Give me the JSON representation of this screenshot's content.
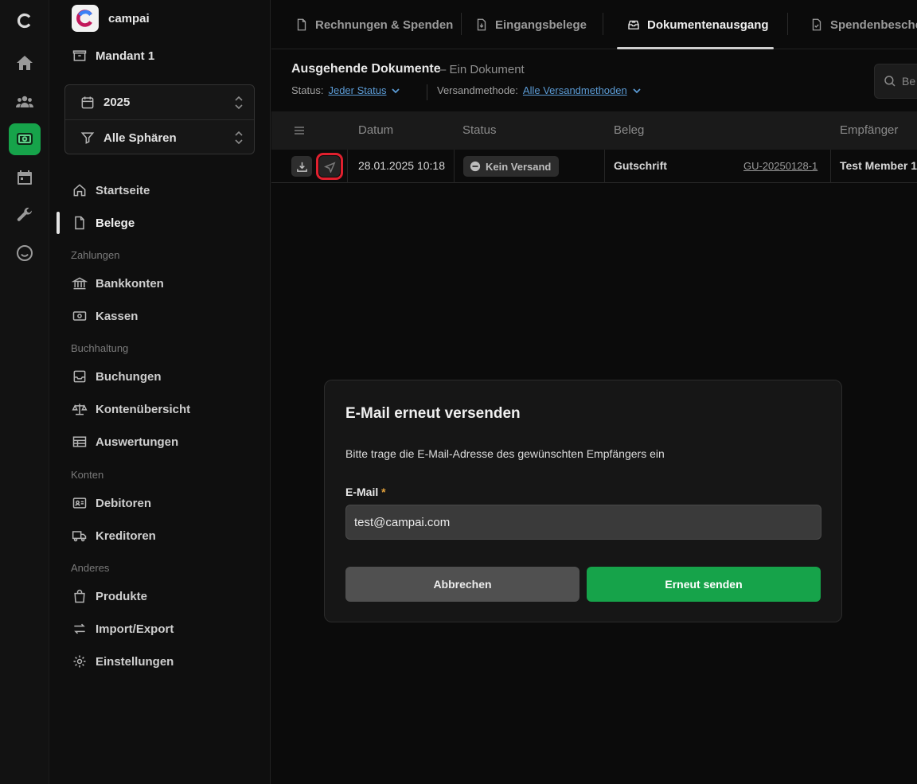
{
  "org": {
    "name": "campai"
  },
  "mandant": {
    "label": "Mandant 1"
  },
  "selector": {
    "year": "2025",
    "sphere": "Alle Sphären"
  },
  "nav": {
    "startseite": "Startseite",
    "belege": "Belege",
    "section_zahlungen": "Zahlungen",
    "bankkonten": "Bankkonten",
    "kassen": "Kassen",
    "section_buchhaltung": "Buchhaltung",
    "buchungen": "Buchungen",
    "kontenuebersicht": "Kontenübersicht",
    "auswertungen": "Auswertungen",
    "section_konten": "Konten",
    "debitoren": "Debitoren",
    "kreditoren": "Kreditoren",
    "section_anderes": "Anderes",
    "produkte": "Produkte",
    "import_export": "Import/Export",
    "einstellungen": "Einstellungen"
  },
  "tabs": {
    "rechnungen": "Rechnungen & Spenden",
    "eingangsbelege": "Eingangsbelege",
    "dokumentenausgang": "Dokumentenausgang",
    "spendenbescheinigungen": "Spendenbesche"
  },
  "header": {
    "title": "Ausgehende Dokumente",
    "subtitle": "– Ein Dokument",
    "status_label": "Status:",
    "status_value": "Jeder Status",
    "method_label": "Versandmethode:",
    "method_value": "Alle Versandmethoden",
    "search_placeholder": "Be"
  },
  "table": {
    "columns": {
      "datum": "Datum",
      "status": "Status",
      "beleg": "Beleg",
      "empfaenger": "Empfänger"
    },
    "row": {
      "date": "28.01.2025 10:18",
      "status": "Kein Versand",
      "beleg_type": "Gutschrift",
      "beleg_number": "GU-20250128-1",
      "recipient": "Test Member 1"
    }
  },
  "modal": {
    "title": "E-Mail erneut versenden",
    "description": "Bitte trage die E-Mail-Adresse des gewünschten Empfängers ein",
    "email_label": "E-Mail",
    "required_mark": "*",
    "email_value": "test@campai.com",
    "cancel_label": "Abbrechen",
    "send_label": "Erneut senden"
  },
  "colors": {
    "accent": "#16a34a",
    "highlight": "#e0202e",
    "link": "#5b9bd5",
    "required": "#e2a13b"
  }
}
